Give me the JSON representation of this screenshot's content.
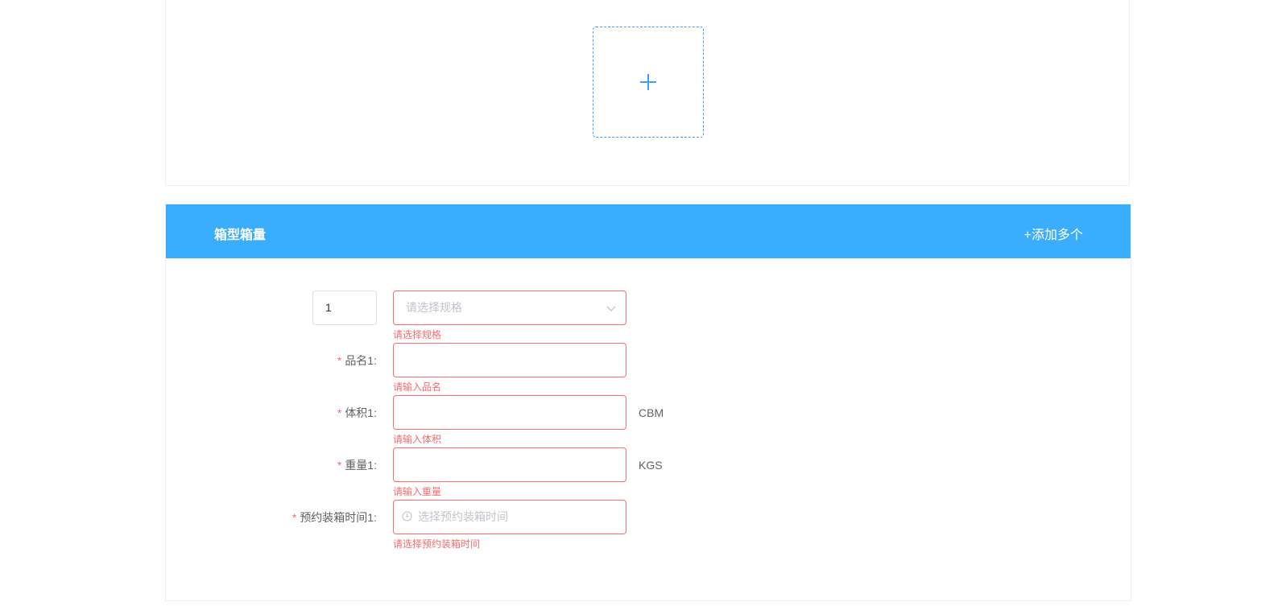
{
  "upload": {
    "plus_icon": "plus-icon",
    "accent": "#409eff"
  },
  "box_section": {
    "title": "箱型箱量",
    "add_more_label": "+添加多个",
    "header_color": "#3aaefc"
  },
  "form": {
    "index_value": "1",
    "spec": {
      "placeholder": "请选择规格",
      "error": "请选择规格",
      "icon": "chevron-down-icon"
    },
    "product_name": {
      "required_mark": "*",
      "label": "品名1:",
      "value": "",
      "error": "请输入品名"
    },
    "volume": {
      "required_mark": "*",
      "label": "体积1:",
      "value": "",
      "unit": "CBM",
      "error": "请输入体积"
    },
    "weight": {
      "required_mark": "*",
      "label": "重量1:",
      "value": "",
      "unit": "KGS",
      "error": "请输入重量"
    },
    "booking_time": {
      "required_mark": "*",
      "label": "预约装箱时间1:",
      "placeholder": "选择预约装箱时间",
      "error": "请选择预约装箱时间",
      "icon": "clock-icon"
    }
  },
  "colors": {
    "error": "#f56c6c",
    "border": "#dcdfe6"
  }
}
